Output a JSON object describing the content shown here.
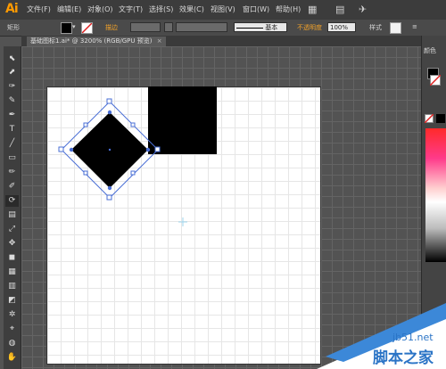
{
  "app": {
    "logo": "Ai"
  },
  "menu": [
    "文件(F)",
    "编辑(E)",
    "对象(O)",
    "文字(T)",
    "选择(S)",
    "效果(C)",
    "视图(V)",
    "窗口(W)",
    "帮助(H)"
  ],
  "control_bar": {
    "shape_label": "矩形",
    "stroke_label": "描边",
    "stroke_style": "基本",
    "opacity_label": "不透明度",
    "opacity_value": "100%",
    "style_label": "样式"
  },
  "document": {
    "tab_title": "基础图标1.ai* @ 3200% (RGB/GPU 预览)",
    "close_glyph": "×"
  },
  "right_panel": {
    "title": "颜色"
  },
  "tools": [
    "⬉",
    "⬈",
    "✑",
    "✎",
    "✒",
    "T",
    "╱",
    "▭",
    "✏",
    "✐",
    "⟳",
    "▤",
    "⤢",
    "✥",
    "◼",
    "▦",
    "▥",
    "◩",
    "✲",
    "⌖",
    "◍",
    "✋"
  ],
  "colors": {
    "menu_bg": "#3c3c3c",
    "canvas_bg": "#535353",
    "accent_orange": "#f0a12a",
    "shape_fill": "#000000",
    "selection": "#4a6fd6"
  },
  "watermark": {
    "site": "jb51.net",
    "text": "脚本之家"
  }
}
